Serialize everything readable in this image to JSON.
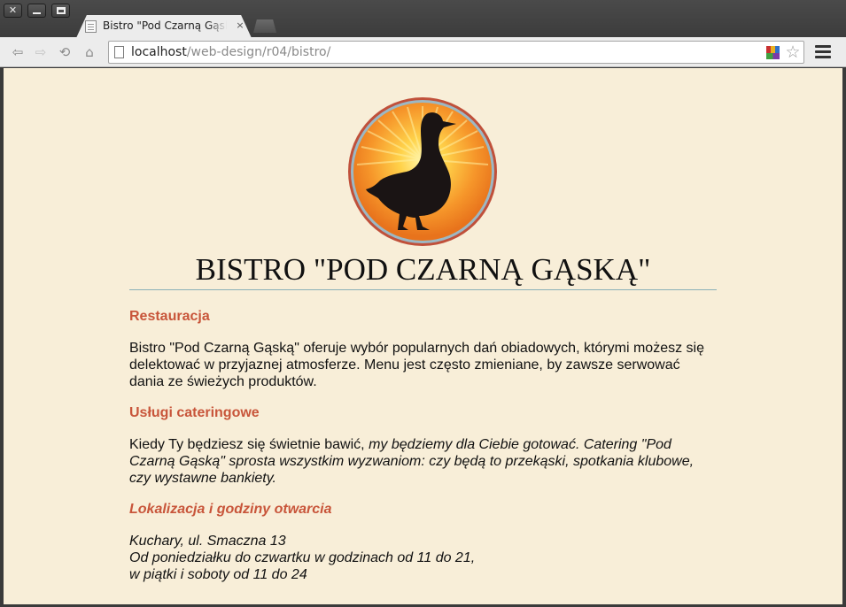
{
  "window": {
    "close_glyph": "✕",
    "tab": {
      "title": "Bistro \"Pod Czarną Gąską\"",
      "close_glyph": "×"
    }
  },
  "toolbar": {
    "back_glyph": "⇦",
    "forward_glyph": "⇨",
    "reload_glyph": "⟲",
    "home_glyph": "⌂",
    "url_host": "localhost",
    "url_path": "/web-design/r04/bistro/",
    "star_glyph": "☆"
  },
  "page": {
    "title": "BISTRO \"POD CZARNĄ GĄSKĄ\"",
    "sections": [
      {
        "heading": "Restauracja",
        "body": "Bistro \"Pod Czarną Gąską\" oferuje wybór popularnych dań obiadowych, którymi możesz się delektować w przyjaznej atmosferze. Menu jest często zmieniane, by zawsze serwować dania ze świeżych produktów."
      },
      {
        "heading": "Usługi cateringowe",
        "body_plain": "Kiedy Ty będziesz się świetnie bawić, ",
        "body_italic": "my będziemy dla Ciebie gotować. Catering \"Pod Czarną Gąską\" sprosta wszystkim wyzwaniom: czy będą to przekąski, spotkania klubowe, czy wystawne bankiety."
      },
      {
        "heading": "Lokalizacja i godziny otwarcia",
        "lines": [
          "Kuchary, ul. Smaczna 13",
          "Od poniedziałku do czwartku w godzinach od 11 do 21,",
          "w piątki i soboty od 11 do 24"
        ]
      }
    ]
  },
  "colors": {
    "page_background": "#f8eed8",
    "heading": "#c8553a",
    "rule": "#8ab0b8",
    "logo_orange": "#f08a24",
    "logo_border": "#c0503a"
  }
}
